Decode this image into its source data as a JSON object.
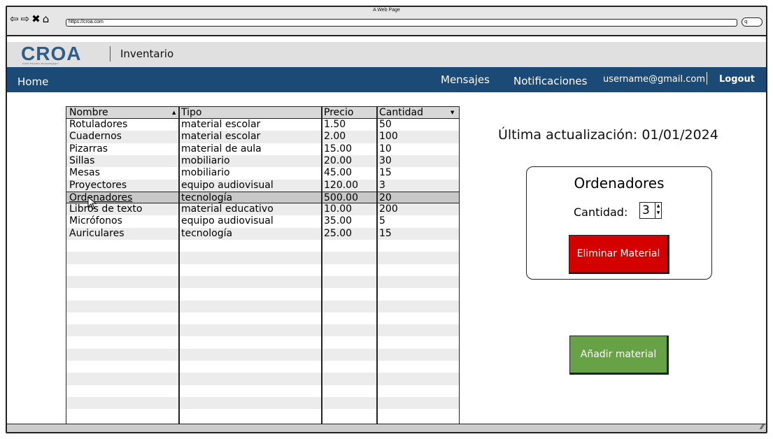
{
  "window": {
    "title": "A Web Page",
    "url": "https://croa.com",
    "search_glyph": "q"
  },
  "header": {
    "logo_text": "CROA",
    "logo_subtitle": "Centro Educativo Psicopedagógico",
    "app_name": "Inventario"
  },
  "navbar": {
    "home": "Home",
    "messages": "Mensajes",
    "notifications": "Notificaciones",
    "user": "username@gmail.com",
    "logout": "Logout",
    "background": "#1a4a75"
  },
  "table": {
    "columns": [
      "Nombre",
      "Tipo",
      "Precio",
      "Cantidad"
    ],
    "rows": [
      [
        "Rotuladores",
        "material escolar",
        "1.50",
        "50"
      ],
      [
        "Cuadernos",
        "material escolar",
        "2.00",
        "100"
      ],
      [
        "Pizarras",
        "material de aula",
        "15.00",
        "10"
      ],
      [
        "Sillas",
        "mobiliario",
        "20.00",
        "30"
      ],
      [
        "Mesas",
        "mobiliario",
        "45.00",
        "15"
      ],
      [
        "Proyectores",
        "equipo audiovisual",
        "120.00",
        "3"
      ],
      [
        "Ordenadores",
        "tecnología",
        "500.00",
        "20"
      ],
      [
        "Libros de texto",
        "material educativo",
        "10.00",
        "200"
      ],
      [
        "Micrófonos",
        "equipo audiovisual",
        "35.00",
        "5"
      ],
      [
        "Auriculares",
        "tecnología",
        "25.00",
        "15"
      ]
    ],
    "selected_index": 6
  },
  "panel": {
    "last_update": "Última actualización: 01/01/2024",
    "card_title": "Ordenadores",
    "qty_label": "Cantidad:",
    "qty_value": "3",
    "delete_button": "Eliminar Material",
    "add_button": "Añadir material",
    "delete_color": "#d40000",
    "add_color": "#68a246"
  },
  "icons": {
    "back": "back-arrow-icon",
    "forward": "forward-arrow-icon",
    "stop": "close-icon",
    "home": "home-icon",
    "cursor": "mouse-pointer-icon"
  }
}
